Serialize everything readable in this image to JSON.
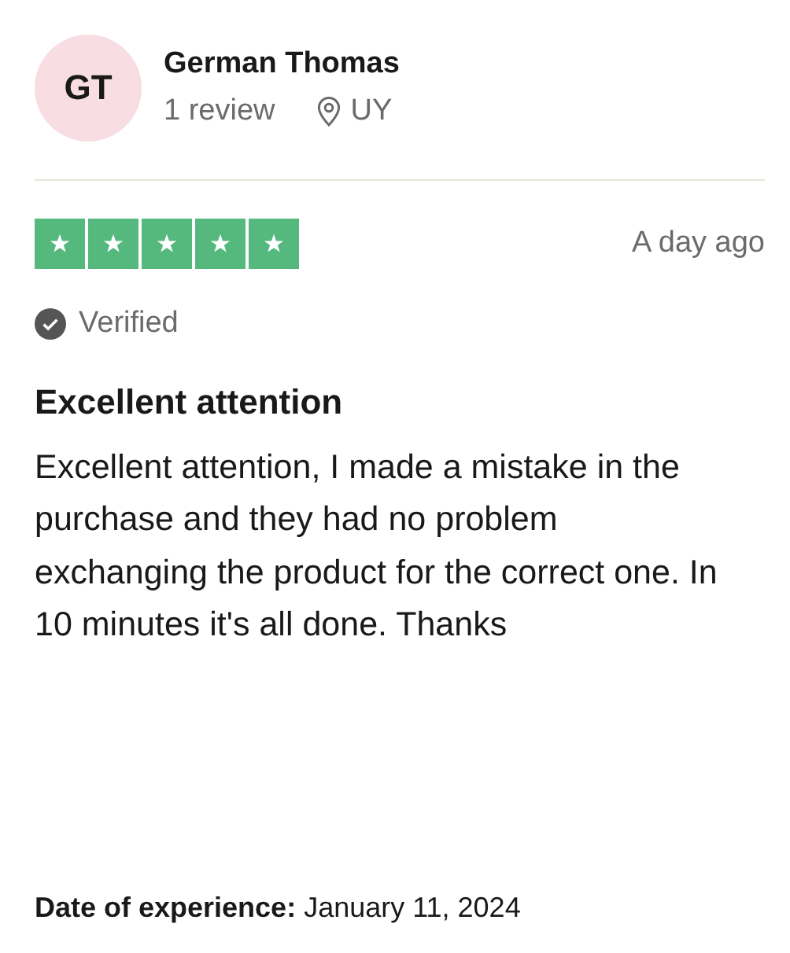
{
  "reviewer": {
    "initials": "GT",
    "name": "German Thomas",
    "reviews": "1 review",
    "country": "UY"
  },
  "rating": {
    "stars": 5
  },
  "date": "A day ago",
  "verified": {
    "label": "Verified"
  },
  "title": "Excellent attention",
  "body": "Excellent attention, I made a mistake in the purchase and they had no problem exchanging the product for the correct one. In 10 minutes it's all done. Thanks",
  "experience": {
    "label": "Date of experience:",
    "value": "January 11, 2024"
  }
}
